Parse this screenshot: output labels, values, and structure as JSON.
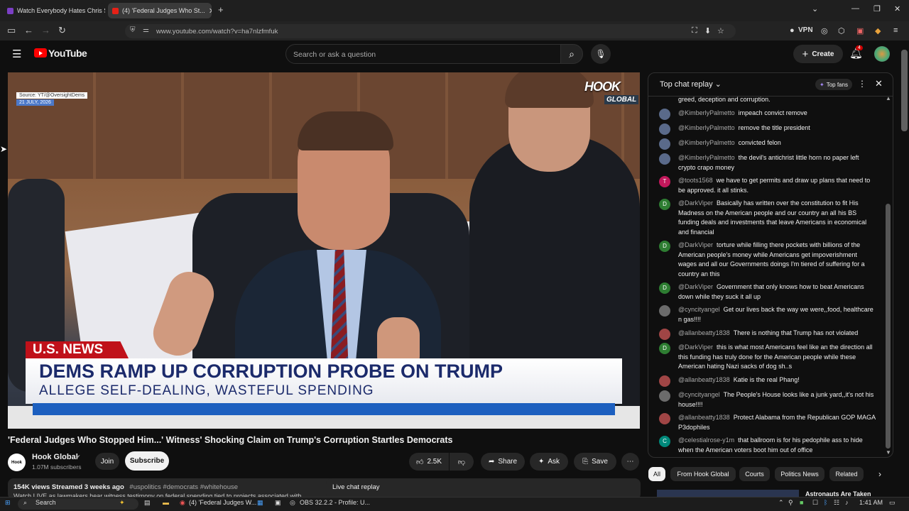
{
  "browser": {
    "tabs": [
      {
        "label": "Watch Everybody Hates Chris S..."
      },
      {
        "label": "(4) 'Federal Judges Who St..."
      }
    ],
    "new_tab": "+",
    "url": "www.youtube.com/watch?v=ha7nlzfmfuk",
    "vpn_label": "VPN"
  },
  "header": {
    "logo": "YouTube",
    "search_placeholder": "Search or ask a question",
    "create_label": "Create",
    "notif_count": "4"
  },
  "video": {
    "source_tag": "Source: YT/@OversightDems",
    "date_tag": "21 JULY, 2026",
    "watermark_top": "HOOK",
    "watermark_bottom": "GLOBAL",
    "news_tag": "U.S. NEWS",
    "headline": "DEMS RAMP UP CORRUPTION PROBE ON TRUMP",
    "subheadline": "ALLEGE SELF-DEALING, WASTEFUL SPENDING",
    "title": "'Federal Judges Who Stopped Him...' Witness' Shocking Claim on Trump's Corruption Startles Democrats"
  },
  "channel": {
    "logo_text": "Hook",
    "name": "Hook Global",
    "subscribers": "1.07M subscribers",
    "join_label": "Join",
    "subscribe_label": "Subscribe"
  },
  "actions": {
    "likes": "2.5K",
    "share": "Share",
    "ask": "Ask",
    "save": "Save"
  },
  "description": {
    "meta": "154K views  Streamed 3 weeks ago",
    "tags": "#uspolitics #democrats #whitehouse",
    "preview": "Watch LIVE as lawmakers hear witness testimony on federal spending tied to projects associated with"
  },
  "live_chat_replay": "Live chat replay",
  "chat": {
    "title": "Top chat replay",
    "top_fans": "Top fans",
    "messages": [
      {
        "user": "",
        "text": "greed, deception and corruption.",
        "avatar": "",
        "color": "#0f0f0f"
      },
      {
        "user": "@KimberlyPalmetto",
        "text": "impeach convict remove",
        "avatar": "",
        "color": "#5a6a8a"
      },
      {
        "user": "@KimberlyPalmetto",
        "text": "remove the title president",
        "avatar": "",
        "color": "#5a6a8a"
      },
      {
        "user": "@KimberlyPalmetto",
        "text": "convicted felon",
        "avatar": "",
        "color": "#5a6a8a"
      },
      {
        "user": "@KimberlyPalmetto",
        "text": "the devil's antichrist little horn no paper left crypto crapo money",
        "avatar": "",
        "color": "#5a6a8a"
      },
      {
        "user": "@toots1568",
        "text": "we have to get permits and draw up plans that need to be approved. it all stinks.",
        "avatar": "T",
        "color": "#c2185b"
      },
      {
        "user": "@DarkViper",
        "text": "Basically has written over the constitution to fit His Madness on the American people and our country an all his BS funding deals and investments that leave Americans in economical and financial",
        "avatar": "D",
        "color": "#2e7d32"
      },
      {
        "user": "@DarkViper",
        "text": "torture while filling there pockets with billions of the American people's money while Americans get impoverishment wages and all our Governments doings I'm tiered of suffering for a country an this",
        "avatar": "D",
        "color": "#2e7d32"
      },
      {
        "user": "@DarkViper",
        "text": "Government that only knows how to beat Americans down while they suck it all up",
        "avatar": "D",
        "color": "#2e7d32"
      },
      {
        "user": "@cyncityangel",
        "text": "Get our lives back the way we were,,food, healthcare n gas!!!!",
        "avatar": "",
        "color": "#6b6b6b"
      },
      {
        "user": "@allanbeatty1838",
        "text": "There is nothing that Trump has not violated",
        "avatar": "",
        "color": "#a04545"
      },
      {
        "user": "@DarkViper",
        "text": "this is what most Americans feel like an the direction all this funding has truly done for the American people while these American hating Nazi sacks of dog sh..s",
        "avatar": "D",
        "color": "#2e7d32"
      },
      {
        "user": "@allanbeatty1838",
        "text": "Katie is the real Phang!",
        "avatar": "",
        "color": "#a04545"
      },
      {
        "user": "@cyncityangel",
        "text": "The People's House looks like a junk yard,,it's not his house!!!!",
        "avatar": "",
        "color": "#6b6b6b"
      },
      {
        "user": "@allanbeatty1838",
        "text": "Protect Alabama from the Republican GOP MAGA P3dophiles",
        "avatar": "",
        "color": "#a04545"
      },
      {
        "user": "@celestialrose-y1m",
        "text": "that ballroom is for his pedophile ass to hide when the American voters boot him out of office",
        "avatar": "C",
        "color": "#00897b"
      }
    ]
  },
  "chips": [
    "All",
    "From Hook Global",
    "Courts",
    "Politics News",
    "Related"
  ],
  "suggested_peek": "Astronauts Are Taken",
  "taskbar": {
    "search": "Search",
    "app1": "(4) 'Federal Judges W...",
    "app2": "OBS 32.2.2 - Profile: U...",
    "time": "1:41 AM"
  }
}
